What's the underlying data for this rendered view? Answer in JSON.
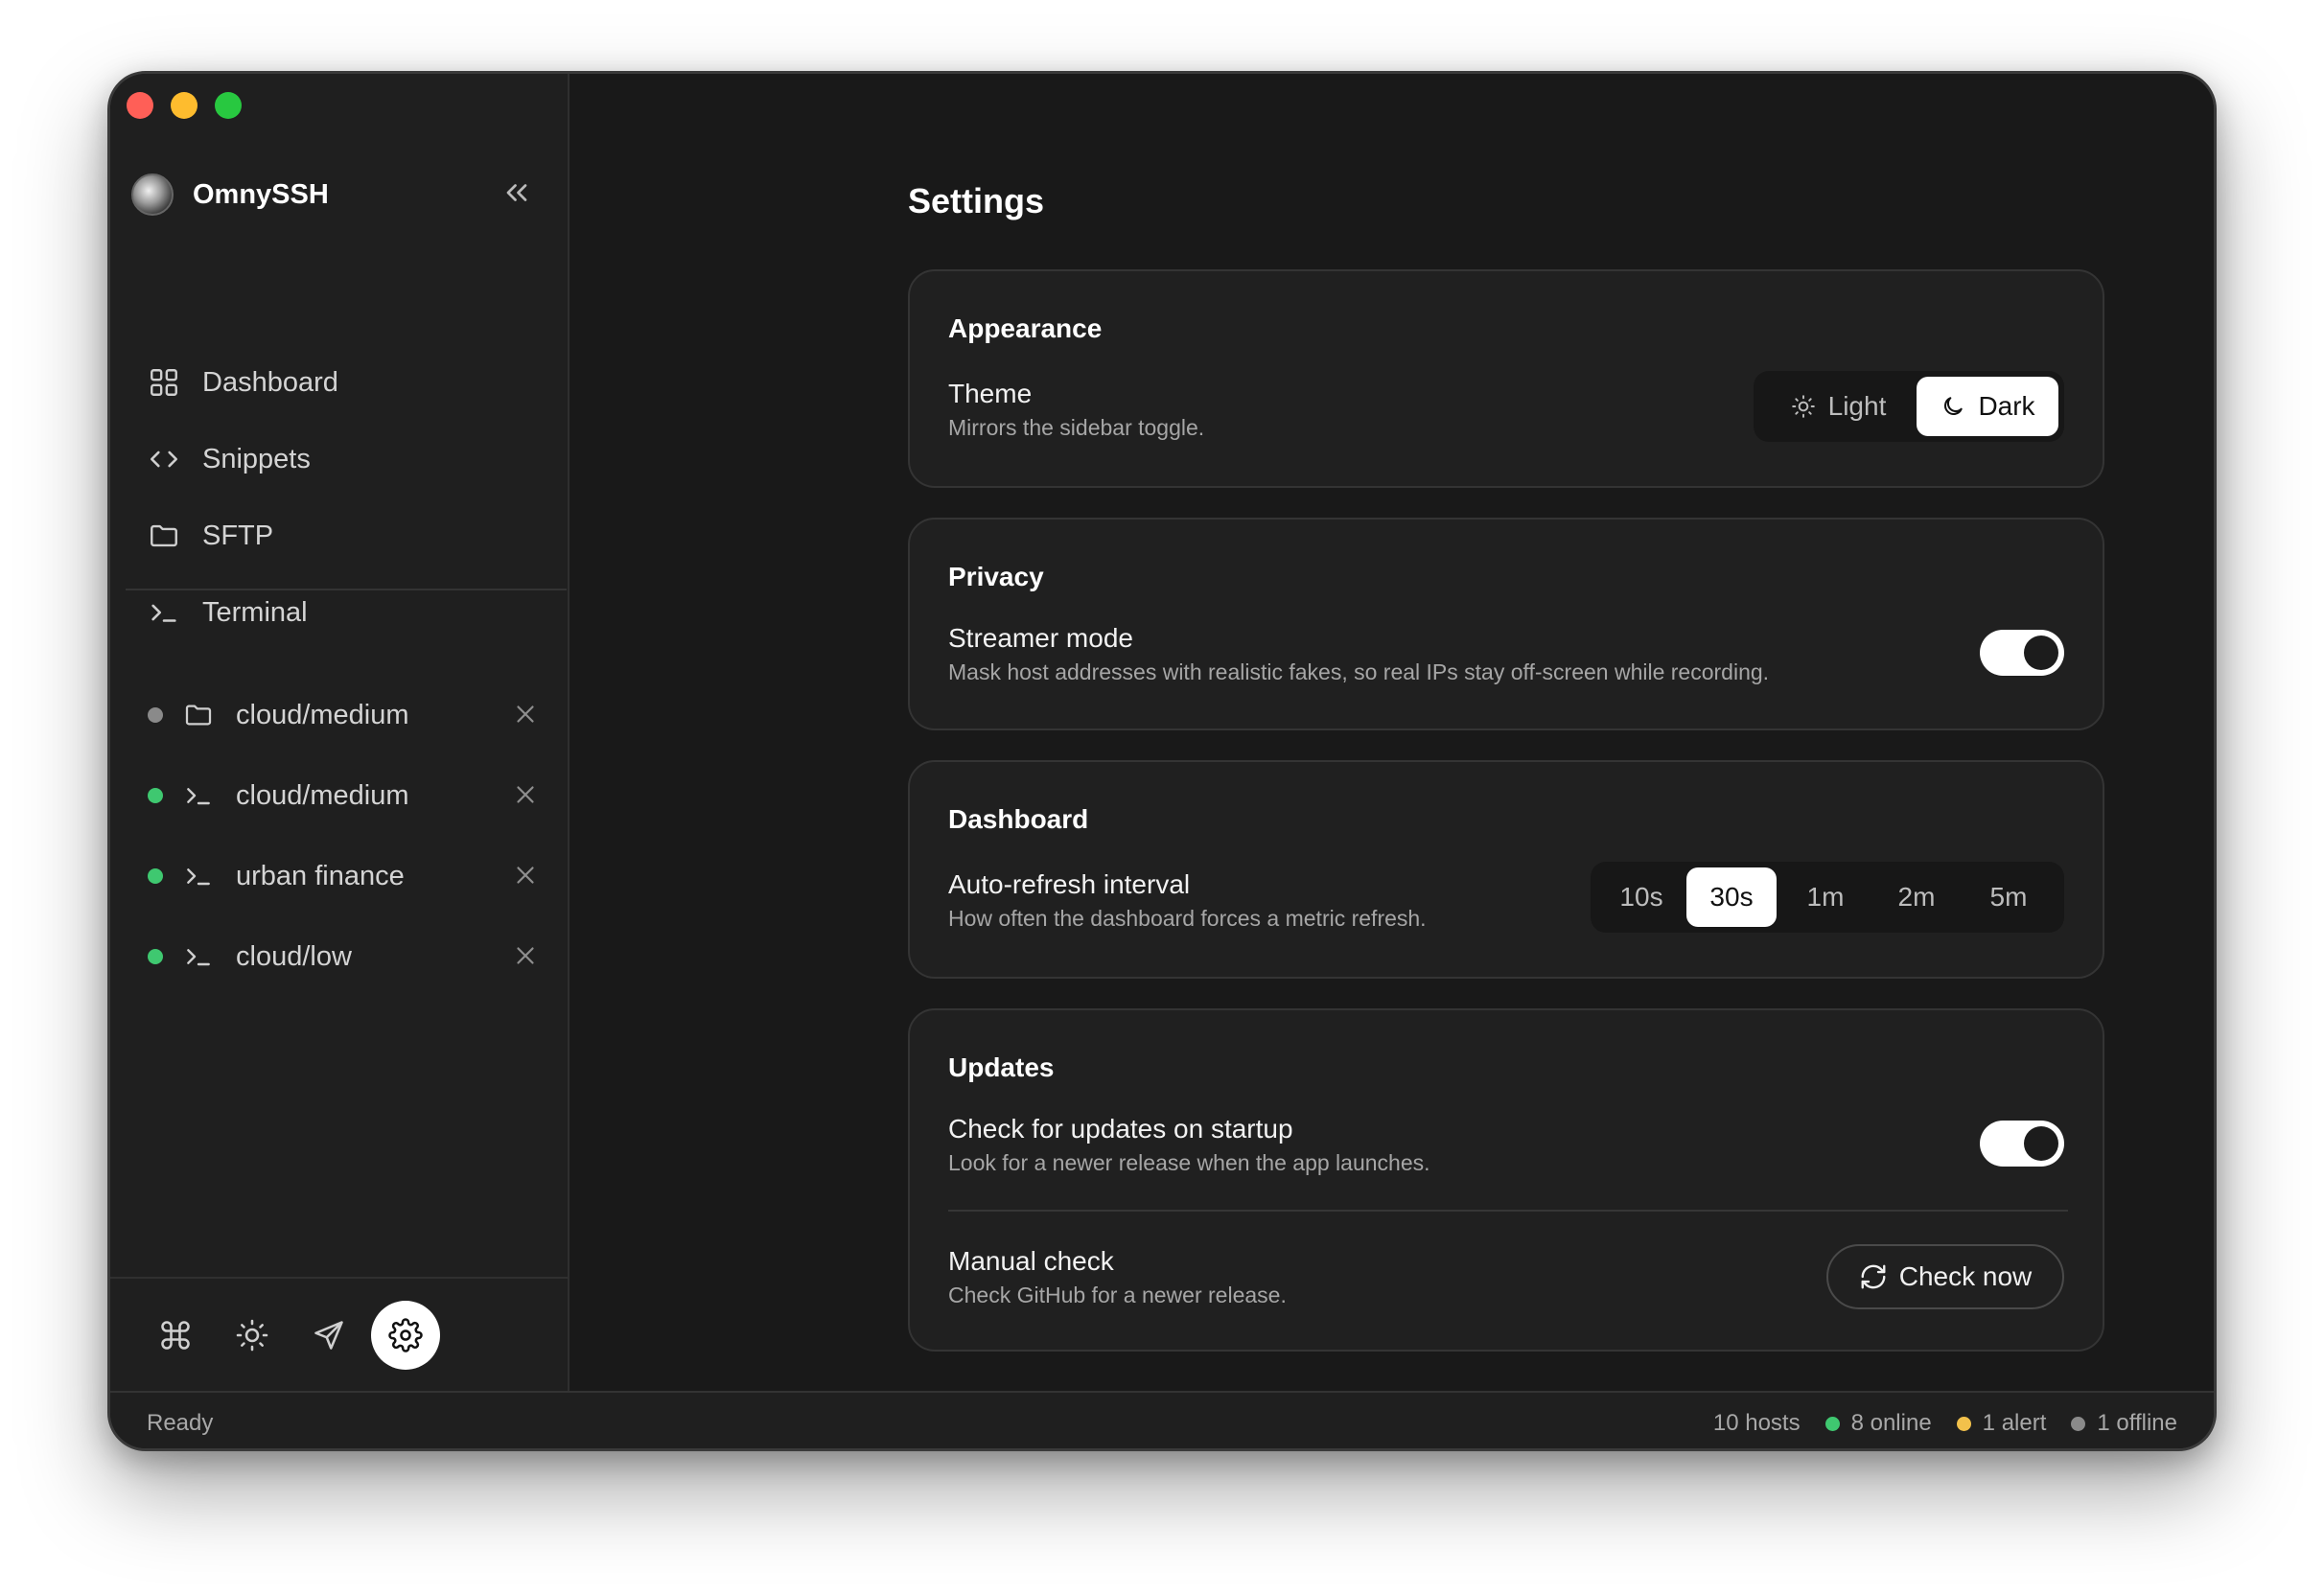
{
  "app": {
    "name": "OmnySSH"
  },
  "nav": {
    "items": [
      {
        "label": "Dashboard",
        "icon": "grid-icon"
      },
      {
        "label": "Snippets",
        "icon": "code-icon"
      },
      {
        "label": "SFTP",
        "icon": "folder-icon"
      },
      {
        "label": "Terminal",
        "icon": "terminal-icon"
      }
    ]
  },
  "sessions": [
    {
      "label": "cloud/medium",
      "type": "sftp",
      "status": "idle"
    },
    {
      "label": "cloud/medium",
      "type": "terminal",
      "status": "online"
    },
    {
      "label": "urban finance",
      "type": "terminal",
      "status": "online"
    },
    {
      "label": "cloud/low",
      "type": "terminal",
      "status": "online"
    }
  ],
  "bottom_icons": [
    "command-icon",
    "sun-icon",
    "send-icon",
    "gear-icon"
  ],
  "page": {
    "title": "Settings"
  },
  "appearance": {
    "title": "Appearance",
    "theme_label": "Theme",
    "theme_desc": "Mirrors the sidebar toggle.",
    "light_label": "Light",
    "dark_label": "Dark",
    "selected": "Dark"
  },
  "privacy": {
    "title": "Privacy",
    "streamer_label": "Streamer mode",
    "streamer_desc": "Mask host addresses with realistic fakes, so real IPs stay off-screen while recording.",
    "streamer_enabled": true
  },
  "dashboard": {
    "title": "Dashboard",
    "refresh_label": "Auto-refresh interval",
    "refresh_desc": "How often the dashboard forces a metric refresh.",
    "intervals": [
      "10s",
      "30s",
      "1m",
      "2m",
      "5m"
    ],
    "selected": "30s"
  },
  "updates": {
    "title": "Updates",
    "startup_label": "Check for updates on startup",
    "startup_desc": "Look for a newer release when the app launches.",
    "startup_enabled": true,
    "manual_label": "Manual check",
    "manual_desc": "Check GitHub for a newer release.",
    "check_button": "Check now"
  },
  "status": {
    "left": "Ready",
    "hosts": "10 hosts",
    "online": "8 online",
    "alert": "1 alert",
    "offline": "1 offline"
  },
  "colors": {
    "online": "#3fc870",
    "alert": "#f2c14b",
    "offline": "#8a8a8a"
  }
}
